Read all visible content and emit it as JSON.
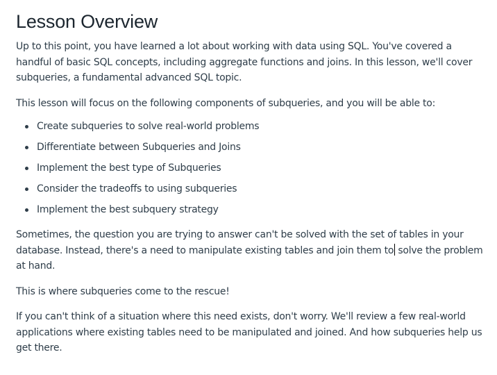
{
  "lesson": {
    "title": "Lesson Overview",
    "intro": "Up to this point, you have learned a lot about working with data using SQL. You've covered a handful of basic SQL concepts, including aggregate functions and joins. In this lesson, we'll cover subqueries, a fundamental advanced SQL topic.",
    "focus_text": "This lesson will focus on the following components of subqueries, and you will be able to:",
    "components": [
      "Create subqueries to solve real-world problems",
      "Differentiate between Subqueries and Joins",
      "Implement the best type of Subqueries",
      "Consider the tradeoffs to using subqueries",
      "Implement the best subquery strategy"
    ],
    "problem_text_before_cursor": "Sometimes, the question you are trying to answer can't be solved with the set of tables in your database. Instead, there's a need to manipulate existing tables and join them to",
    "problem_text_after_cursor": " solve the problem at hand.",
    "rescue_text": "This is where subqueries come to the rescue!",
    "closing_text": "If you can't think of a situation where this need exists, don't worry. We'll review a few real-world applications where existing tables need to be manipulated and joined. And how subqueries help us get there."
  }
}
